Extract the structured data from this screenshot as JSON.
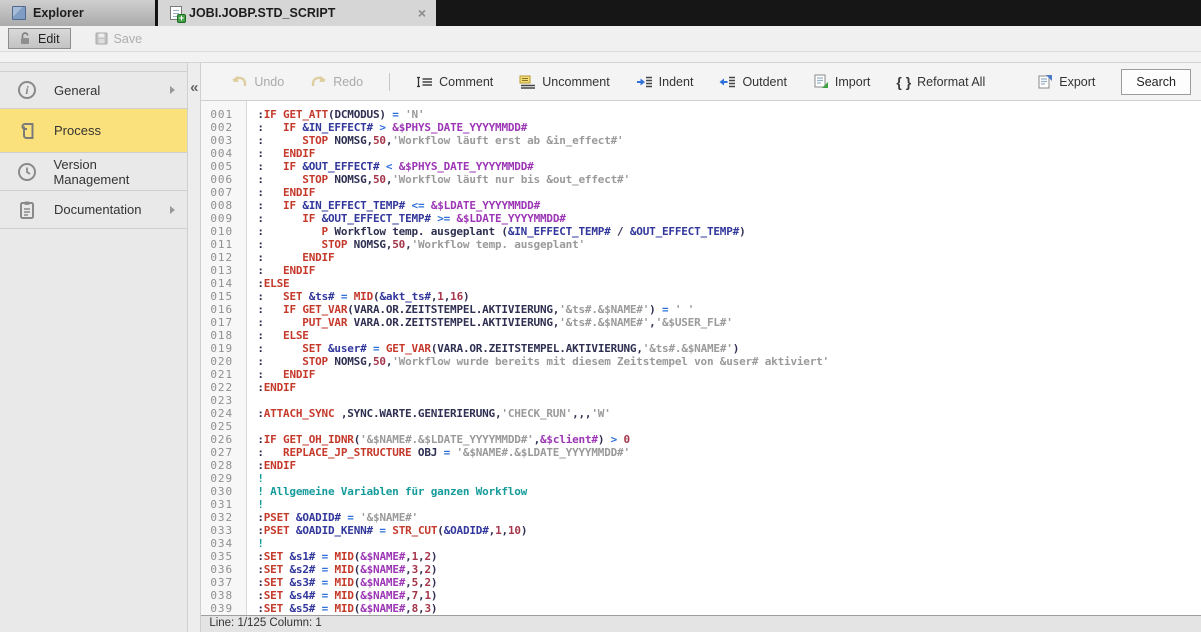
{
  "tabs": {
    "explorer": "Explorer",
    "active": "JOBI.JOBP.STD_SCRIPT"
  },
  "icons": {
    "close": "×",
    "collapse": "«",
    "reformat_braces": "{ }"
  },
  "actions": {
    "edit": "Edit",
    "save": "Save"
  },
  "sidebar": {
    "items": [
      {
        "label": "General",
        "has_arrow": true
      },
      {
        "label": "Process",
        "active": true
      },
      {
        "label": "Version Management"
      },
      {
        "label": "Documentation",
        "has_arrow": true
      }
    ]
  },
  "toolbar": {
    "undo": "Undo",
    "redo": "Redo",
    "comment": "Comment",
    "uncomment": "Uncomment",
    "indent": "Indent",
    "outdent": "Outdent",
    "import": "Import",
    "reformat": "Reformat All",
    "export": "Export",
    "search": "Search"
  },
  "statusbar": {
    "text": "Line: 1/125 Column: 1"
  },
  "colors": {
    "active_item": "#fbe17b",
    "keyword": "#c5392b",
    "variable": "#32379b",
    "promptvar": "#9c36b5",
    "operator": "#2e6fd9",
    "string": "#9a9a9a",
    "number": "#a5354a",
    "comment": "#169b9b",
    "plain": "#2f2f52"
  },
  "code": {
    "lines": [
      {
        "n": "001",
        "s": [
          [
            "p",
            ":"
          ],
          [
            "k",
            "IF"
          ],
          [
            "p",
            " "
          ],
          [
            "k",
            "GET_ATT"
          ],
          [
            "p",
            "(DCMODUS) "
          ],
          [
            "o",
            "="
          ],
          [
            "p",
            " "
          ],
          [
            "s",
            "'N'"
          ]
        ]
      },
      {
        "n": "002",
        "s": [
          [
            "p",
            ":   "
          ],
          [
            "k",
            "IF"
          ],
          [
            "p",
            " "
          ],
          [
            "v",
            "&IN_EFFECT#"
          ],
          [
            "p",
            " "
          ],
          [
            "o",
            ">"
          ],
          [
            "p",
            " "
          ],
          [
            "d",
            "&$PHYS_DATE_YYYYMMDD#"
          ]
        ]
      },
      {
        "n": "003",
        "s": [
          [
            "p",
            ":      "
          ],
          [
            "k",
            "STOP"
          ],
          [
            "p",
            " NOMSG,"
          ],
          [
            "n",
            "50"
          ],
          [
            "p",
            ","
          ],
          [
            "s",
            "'Workflow läuft erst ab &in_effect#'"
          ]
        ]
      },
      {
        "n": "004",
        "s": [
          [
            "p",
            ":   "
          ],
          [
            "k",
            "ENDIF"
          ]
        ]
      },
      {
        "n": "005",
        "s": [
          [
            "p",
            ":   "
          ],
          [
            "k",
            "IF"
          ],
          [
            "p",
            " "
          ],
          [
            "v",
            "&OUT_EFFECT#"
          ],
          [
            "p",
            " "
          ],
          [
            "o",
            "<"
          ],
          [
            "p",
            " "
          ],
          [
            "d",
            "&$PHYS_DATE_YYYYMMDD#"
          ]
        ]
      },
      {
        "n": "006",
        "s": [
          [
            "p",
            ":      "
          ],
          [
            "k",
            "STOP"
          ],
          [
            "p",
            " NOMSG,"
          ],
          [
            "n",
            "50"
          ],
          [
            "p",
            ","
          ],
          [
            "s",
            "'Workflow läuft nur bis &out_effect#'"
          ]
        ]
      },
      {
        "n": "007",
        "s": [
          [
            "p",
            ":   "
          ],
          [
            "k",
            "ENDIF"
          ]
        ]
      },
      {
        "n": "008",
        "s": [
          [
            "p",
            ":   "
          ],
          [
            "k",
            "IF"
          ],
          [
            "p",
            " "
          ],
          [
            "v",
            "&IN_EFFECT_TEMP#"
          ],
          [
            "p",
            " "
          ],
          [
            "o",
            "<="
          ],
          [
            "p",
            " "
          ],
          [
            "d",
            "&$LDATE_YYYYMMDD#"
          ]
        ]
      },
      {
        "n": "009",
        "s": [
          [
            "p",
            ":      "
          ],
          [
            "k",
            "IF"
          ],
          [
            "p",
            " "
          ],
          [
            "v",
            "&OUT_EFFECT_TEMP#"
          ],
          [
            "p",
            " "
          ],
          [
            "o",
            ">="
          ],
          [
            "p",
            " "
          ],
          [
            "d",
            "&$LDATE_YYYYMMDD#"
          ]
        ]
      },
      {
        "n": "010",
        "s": [
          [
            "p",
            ":         "
          ],
          [
            "k",
            "P"
          ],
          [
            "p",
            " Workflow temp. ausgeplant ("
          ],
          [
            "v",
            "&IN_EFFECT_TEMP#"
          ],
          [
            "p",
            " / "
          ],
          [
            "v",
            "&OUT_EFFECT_TEMP#"
          ],
          [
            "p",
            ")"
          ]
        ]
      },
      {
        "n": "011",
        "s": [
          [
            "p",
            ":         "
          ],
          [
            "k",
            "STOP"
          ],
          [
            "p",
            " NOMSG,"
          ],
          [
            "n",
            "50"
          ],
          [
            "p",
            ","
          ],
          [
            "s",
            "'Workflow temp. ausgeplant'"
          ]
        ]
      },
      {
        "n": "012",
        "s": [
          [
            "p",
            ":      "
          ],
          [
            "k",
            "ENDIF"
          ]
        ]
      },
      {
        "n": "013",
        "s": [
          [
            "p",
            ":   "
          ],
          [
            "k",
            "ENDIF"
          ]
        ]
      },
      {
        "n": "014",
        "s": [
          [
            "p",
            ":"
          ],
          [
            "k",
            "ELSE"
          ]
        ]
      },
      {
        "n": "015",
        "s": [
          [
            "p",
            ":   "
          ],
          [
            "k",
            "SET"
          ],
          [
            "p",
            " "
          ],
          [
            "v",
            "&ts#"
          ],
          [
            "p",
            " "
          ],
          [
            "o",
            "="
          ],
          [
            "p",
            " "
          ],
          [
            "k",
            "MID"
          ],
          [
            "p",
            "("
          ],
          [
            "v",
            "&akt_ts#"
          ],
          [
            "p",
            ","
          ],
          [
            "n",
            "1"
          ],
          [
            "p",
            ","
          ],
          [
            "n",
            "16"
          ],
          [
            "p",
            ")"
          ]
        ]
      },
      {
        "n": "016",
        "s": [
          [
            "p",
            ":   "
          ],
          [
            "k",
            "IF"
          ],
          [
            "p",
            " "
          ],
          [
            "k",
            "GET_VAR"
          ],
          [
            "p",
            "(VARA.OR.ZEITSTEMPEL.AKTIVIERUNG,"
          ],
          [
            "s",
            "'&ts#.&$NAME#'"
          ],
          [
            "p",
            ") "
          ],
          [
            "o",
            "="
          ],
          [
            "p",
            " "
          ],
          [
            "s",
            "' '"
          ]
        ]
      },
      {
        "n": "017",
        "s": [
          [
            "p",
            ":      "
          ],
          [
            "k",
            "PUT_VAR"
          ],
          [
            "p",
            " VARA.OR.ZEITSTEMPEL.AKTIVIERUNG,"
          ],
          [
            "s",
            "'&ts#.&$NAME#'"
          ],
          [
            "p",
            ","
          ],
          [
            "s",
            "'&$USER_FL#'"
          ]
        ]
      },
      {
        "n": "018",
        "s": [
          [
            "p",
            ":   "
          ],
          [
            "k",
            "ELSE"
          ]
        ]
      },
      {
        "n": "019",
        "s": [
          [
            "p",
            ":      "
          ],
          [
            "k",
            "SET"
          ],
          [
            "p",
            " "
          ],
          [
            "v",
            "&user#"
          ],
          [
            "p",
            " "
          ],
          [
            "o",
            "="
          ],
          [
            "p",
            " "
          ],
          [
            "k",
            "GET_VAR"
          ],
          [
            "p",
            "(VARA.OR.ZEITSTEMPEL.AKTIVIERUNG,"
          ],
          [
            "s",
            "'&ts#.&$NAME#'"
          ],
          [
            "p",
            ")"
          ]
        ]
      },
      {
        "n": "020",
        "s": [
          [
            "p",
            ":      "
          ],
          [
            "k",
            "STOP"
          ],
          [
            "p",
            " NOMSG,"
          ],
          [
            "n",
            "50"
          ],
          [
            "p",
            ","
          ],
          [
            "s",
            "'Workflow wurde bereits mit diesem Zeitstempel von &user# aktiviert'"
          ]
        ]
      },
      {
        "n": "021",
        "s": [
          [
            "p",
            ":   "
          ],
          [
            "k",
            "ENDIF"
          ]
        ]
      },
      {
        "n": "022",
        "s": [
          [
            "p",
            ":"
          ],
          [
            "k",
            "ENDIF"
          ]
        ]
      },
      {
        "n": "023",
        "s": []
      },
      {
        "n": "024",
        "s": [
          [
            "p",
            ":"
          ],
          [
            "k",
            "ATTACH_SYNC"
          ],
          [
            "p",
            " ,SYNC.WARTE.GENIERIERUNG,"
          ],
          [
            "s",
            "'CHECK_RUN'"
          ],
          [
            "p",
            ",,,"
          ],
          [
            "s",
            "'W'"
          ]
        ]
      },
      {
        "n": "025",
        "s": []
      },
      {
        "n": "026",
        "s": [
          [
            "p",
            ":"
          ],
          [
            "k",
            "IF"
          ],
          [
            "p",
            " "
          ],
          [
            "k",
            "GET_OH_IDNR"
          ],
          [
            "p",
            "("
          ],
          [
            "s",
            "'&$NAME#.&$LDATE_YYYYMMDD#'"
          ],
          [
            "p",
            ","
          ],
          [
            "d",
            "&$client#"
          ],
          [
            "p",
            ") "
          ],
          [
            "o",
            ">"
          ],
          [
            "p",
            " "
          ],
          [
            "n",
            "0"
          ]
        ]
      },
      {
        "n": "027",
        "s": [
          [
            "p",
            ":   "
          ],
          [
            "k",
            "REPLACE_JP_STRUCTURE"
          ],
          [
            "p",
            " OBJ "
          ],
          [
            "o",
            "="
          ],
          [
            "p",
            " "
          ],
          [
            "s",
            "'&$NAME#.&$LDATE_YYYYMMDD#'"
          ]
        ]
      },
      {
        "n": "028",
        "s": [
          [
            "p",
            ":"
          ],
          [
            "k",
            "ENDIF"
          ]
        ]
      },
      {
        "n": "029",
        "s": [
          [
            "c",
            "!"
          ]
        ]
      },
      {
        "n": "030",
        "s": [
          [
            "c",
            "! Allgemeine Variablen für ganzen Workflow"
          ]
        ]
      },
      {
        "n": "031",
        "s": [
          [
            "c",
            "!"
          ]
        ]
      },
      {
        "n": "032",
        "s": [
          [
            "p",
            ":"
          ],
          [
            "k",
            "PSET"
          ],
          [
            "p",
            " "
          ],
          [
            "v",
            "&OADID#"
          ],
          [
            "p",
            " "
          ],
          [
            "o",
            "="
          ],
          [
            "p",
            " "
          ],
          [
            "s",
            "'&$NAME#'"
          ]
        ]
      },
      {
        "n": "033",
        "s": [
          [
            "p",
            ":"
          ],
          [
            "k",
            "PSET"
          ],
          [
            "p",
            " "
          ],
          [
            "v",
            "&OADID_KENN#"
          ],
          [
            "p",
            " "
          ],
          [
            "o",
            "="
          ],
          [
            "p",
            " "
          ],
          [
            "k",
            "STR_CUT"
          ],
          [
            "p",
            "("
          ],
          [
            "v",
            "&OADID#"
          ],
          [
            "p",
            ","
          ],
          [
            "n",
            "1"
          ],
          [
            "p",
            ","
          ],
          [
            "n",
            "10"
          ],
          [
            "p",
            ")"
          ]
        ]
      },
      {
        "n": "034",
        "s": [
          [
            "c",
            "!"
          ]
        ]
      },
      {
        "n": "035",
        "s": [
          [
            "p",
            ":"
          ],
          [
            "k",
            "SET"
          ],
          [
            "p",
            " "
          ],
          [
            "v",
            "&s1#"
          ],
          [
            "p",
            " "
          ],
          [
            "o",
            "="
          ],
          [
            "p",
            " "
          ],
          [
            "k",
            "MID"
          ],
          [
            "p",
            "("
          ],
          [
            "d",
            "&$NAME#"
          ],
          [
            "p",
            ","
          ],
          [
            "n",
            "1"
          ],
          [
            "p",
            ","
          ],
          [
            "n",
            "2"
          ],
          [
            "p",
            ")"
          ]
        ]
      },
      {
        "n": "036",
        "s": [
          [
            "p",
            ":"
          ],
          [
            "k",
            "SET"
          ],
          [
            "p",
            " "
          ],
          [
            "v",
            "&s2#"
          ],
          [
            "p",
            " "
          ],
          [
            "o",
            "="
          ],
          [
            "p",
            " "
          ],
          [
            "k",
            "MID"
          ],
          [
            "p",
            "("
          ],
          [
            "d",
            "&$NAME#"
          ],
          [
            "p",
            ","
          ],
          [
            "n",
            "3"
          ],
          [
            "p",
            ","
          ],
          [
            "n",
            "2"
          ],
          [
            "p",
            ")"
          ]
        ]
      },
      {
        "n": "037",
        "s": [
          [
            "p",
            ":"
          ],
          [
            "k",
            "SET"
          ],
          [
            "p",
            " "
          ],
          [
            "v",
            "&s3#"
          ],
          [
            "p",
            " "
          ],
          [
            "o",
            "="
          ],
          [
            "p",
            " "
          ],
          [
            "k",
            "MID"
          ],
          [
            "p",
            "("
          ],
          [
            "d",
            "&$NAME#"
          ],
          [
            "p",
            ","
          ],
          [
            "n",
            "5"
          ],
          [
            "p",
            ","
          ],
          [
            "n",
            "2"
          ],
          [
            "p",
            ")"
          ]
        ]
      },
      {
        "n": "038",
        "s": [
          [
            "p",
            ":"
          ],
          [
            "k",
            "SET"
          ],
          [
            "p",
            " "
          ],
          [
            "v",
            "&s4#"
          ],
          [
            "p",
            " "
          ],
          [
            "o",
            "="
          ],
          [
            "p",
            " "
          ],
          [
            "k",
            "MID"
          ],
          [
            "p",
            "("
          ],
          [
            "d",
            "&$NAME#"
          ],
          [
            "p",
            ","
          ],
          [
            "n",
            "7"
          ],
          [
            "p",
            ","
          ],
          [
            "n",
            "1"
          ],
          [
            "p",
            ")"
          ]
        ]
      },
      {
        "n": "039",
        "s": [
          [
            "p",
            ":"
          ],
          [
            "k",
            "SET"
          ],
          [
            "p",
            " "
          ],
          [
            "v",
            "&s5#"
          ],
          [
            "p",
            " "
          ],
          [
            "o",
            "="
          ],
          [
            "p",
            " "
          ],
          [
            "k",
            "MID"
          ],
          [
            "p",
            "("
          ],
          [
            "d",
            "&$NAME#"
          ],
          [
            "p",
            ","
          ],
          [
            "n",
            "8"
          ],
          [
            "p",
            ","
          ],
          [
            "n",
            "3"
          ],
          [
            "p",
            ")"
          ]
        ]
      }
    ]
  }
}
